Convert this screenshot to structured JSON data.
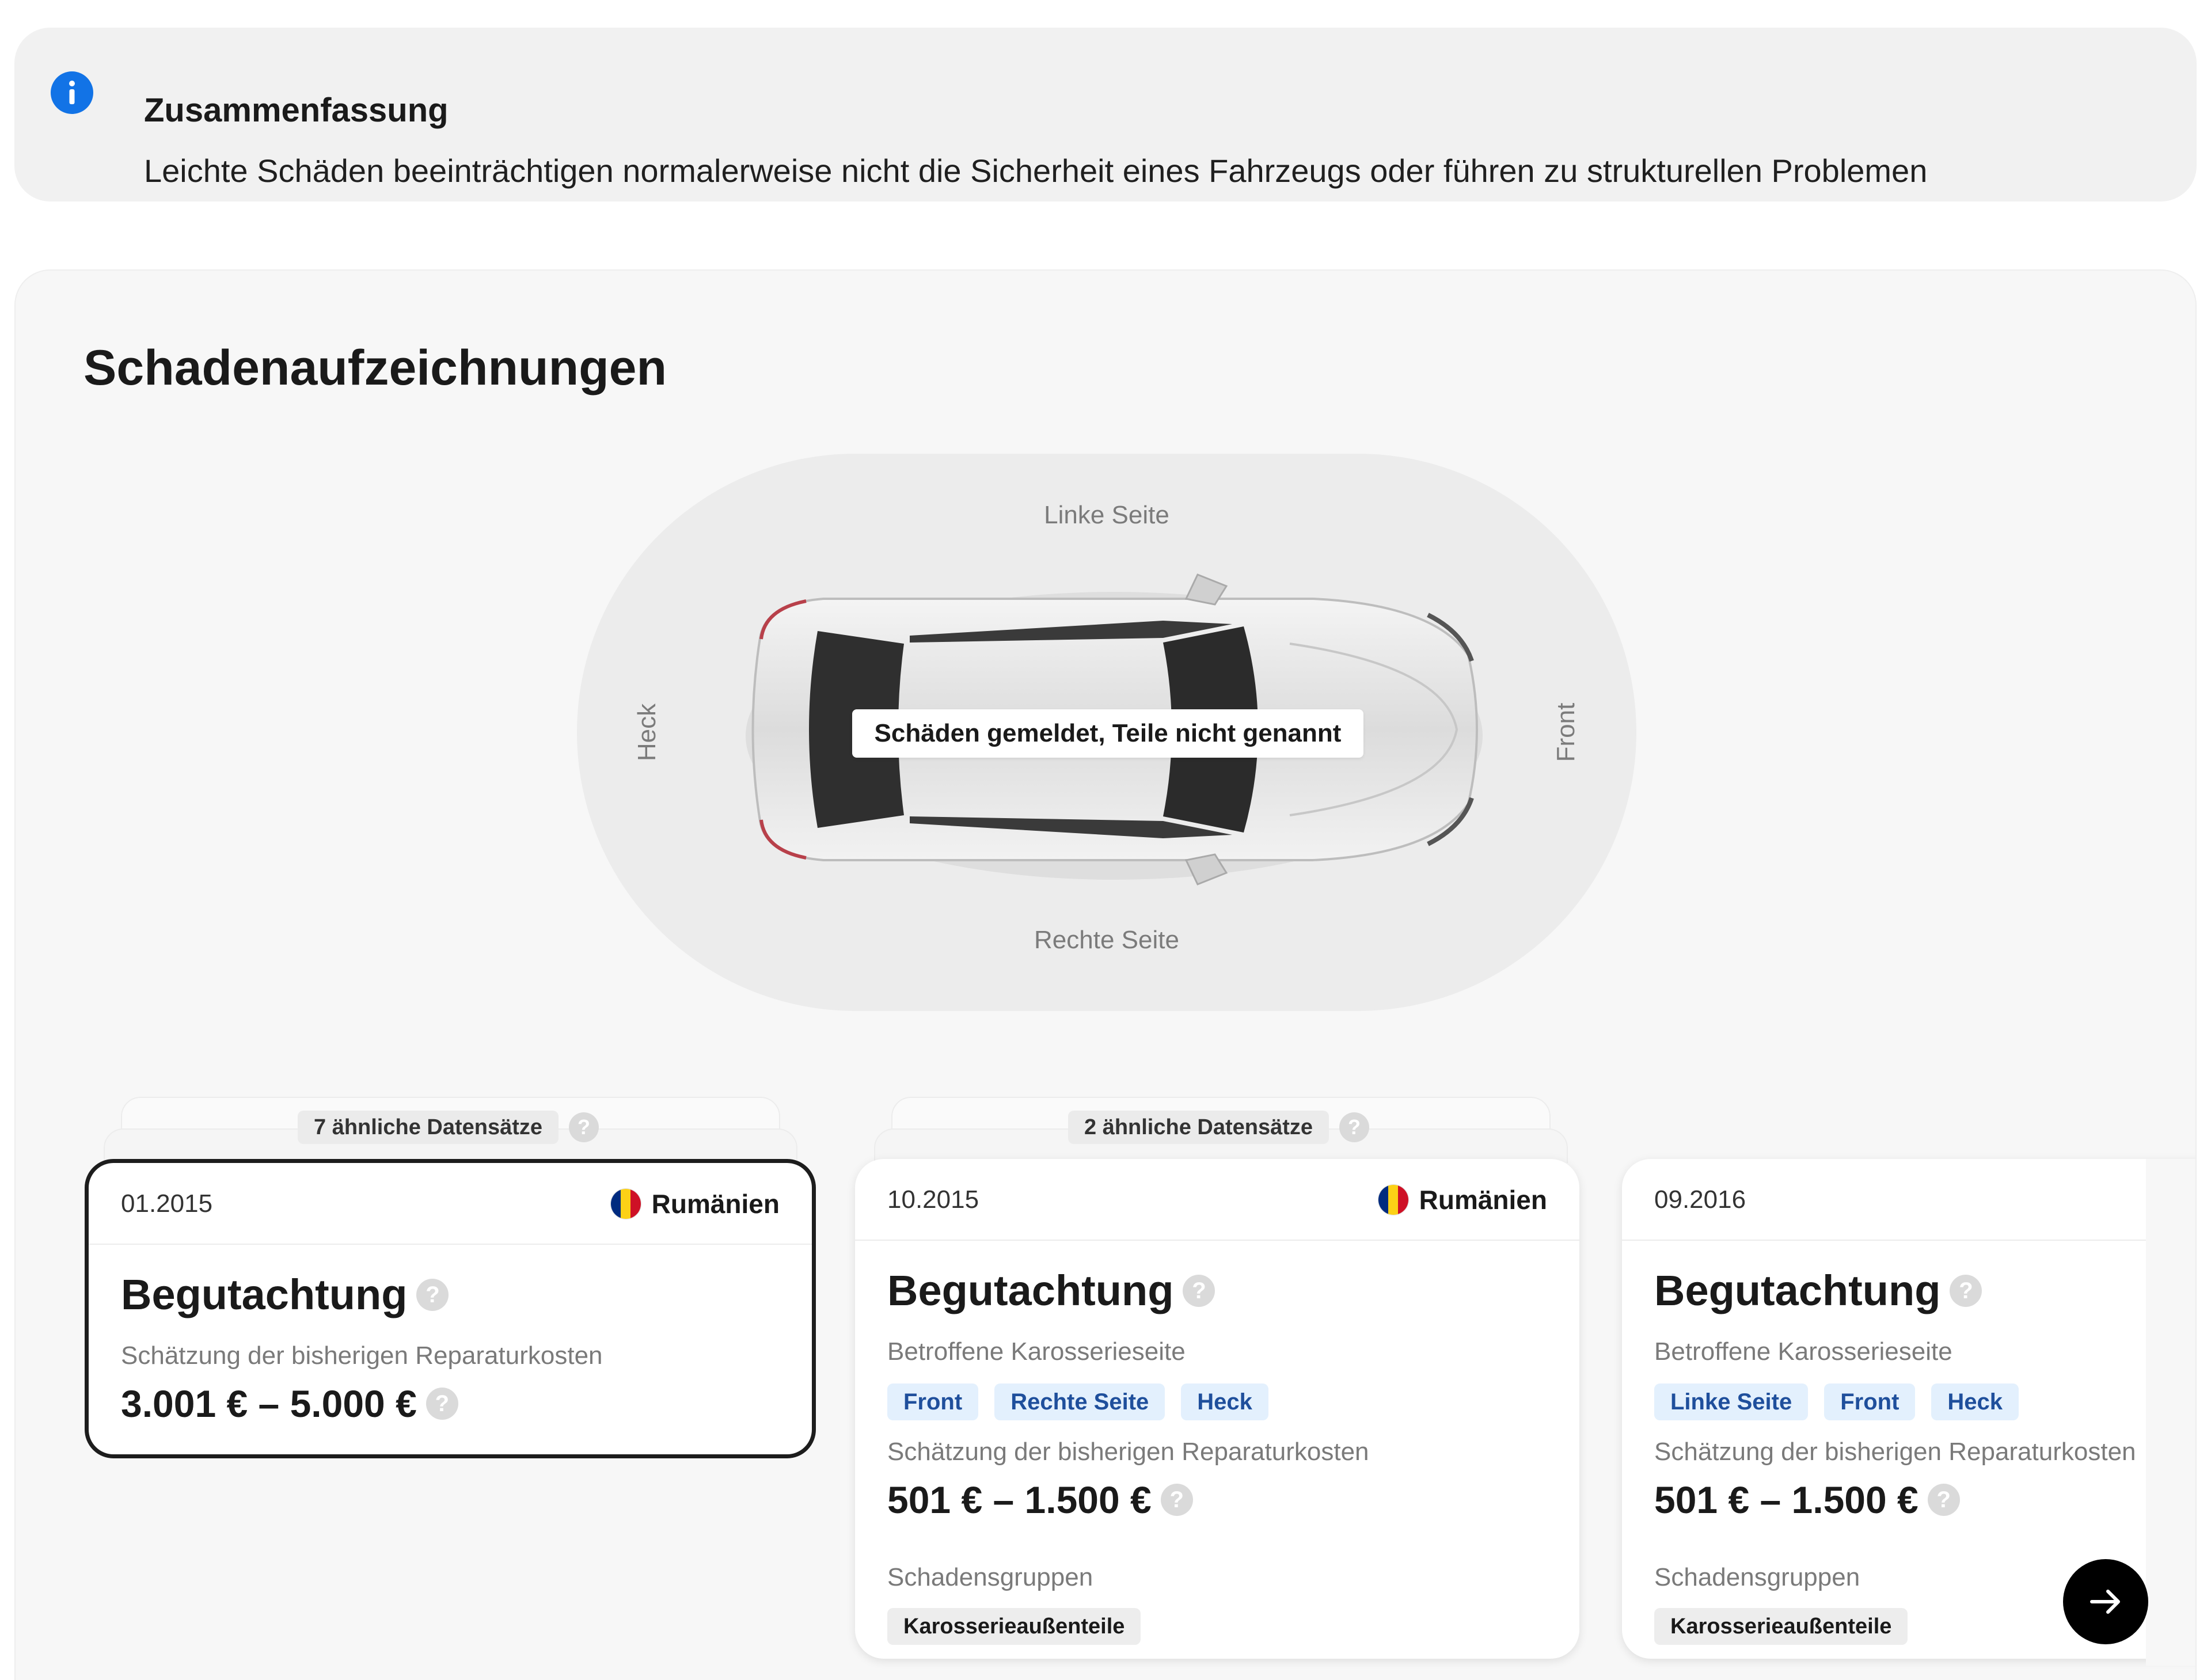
{
  "summary": {
    "icon": "info-icon",
    "title": "Zusammenfassung",
    "text": "Leichte Schäden beeinträchtigen normalerweise nicht die Sicherheit eines Fahrzeugs oder führen zu strukturellen Problemen"
  },
  "damage": {
    "title": "Schadenaufzeichnungen",
    "diagram": {
      "left_side": "Linke Seite",
      "right_side": "Rechte Seite",
      "rear": "Heck",
      "front": "Front",
      "note": "Schäden gemeldet, Teile nicht genannt"
    },
    "help_symbol": "?",
    "records": [
      {
        "similar": "7 ähnliche Datensätze",
        "date": "01.2015",
        "country": "Rumänien",
        "type": "Begutachtung",
        "cost_label": "Schätzung der bisherigen Reparaturkosten",
        "cost": "3.001 € – 5.000 €",
        "selected": true
      },
      {
        "similar": "2 ähnliche Datensätze",
        "date": "10.2015",
        "country": "Rumänien",
        "type": "Begutachtung",
        "sides_label": "Betroffene Karosserieseite",
        "sides": [
          "Front",
          "Rechte Seite",
          "Heck"
        ],
        "cost_label": "Schätzung der bisherigen Reparaturkosten",
        "cost": "501 € – 1.500 €",
        "groups_label": "Schadensgruppen",
        "groups": [
          "Karosserieaußenteile"
        ]
      },
      {
        "date": "09.2016",
        "type": "Begutachtung",
        "sides_label": "Betroffene Karosserieseite",
        "sides": [
          "Linke Seite",
          "Front",
          "Heck"
        ],
        "cost_label": "Schätzung der bisherigen Reparaturkosten",
        "cost": "501 € – 1.500 €",
        "groups_label": "Schadensgruppen",
        "groups": [
          "Karosserieaußenteile"
        ]
      }
    ],
    "flag_colors": [
      "#002b7f",
      "#fcd116",
      "#ce1126"
    ],
    "next_icon": "arrow-right-icon"
  }
}
